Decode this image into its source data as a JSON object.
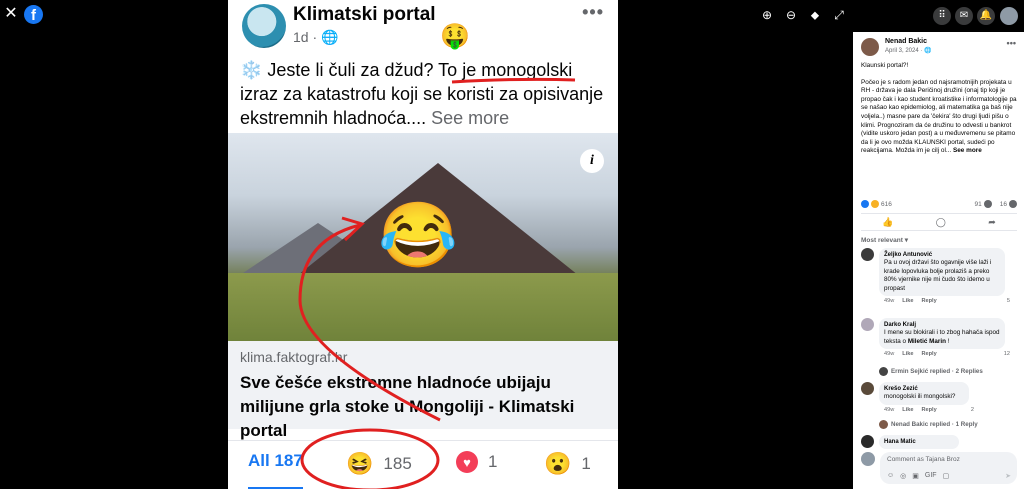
{
  "viewer": {
    "close_icon": "✕",
    "logo_letter": "f",
    "tools": [
      "⊕",
      "⊖",
      "⬥",
      "⤢"
    ]
  },
  "post": {
    "page_name": "Klimatski portal",
    "meta": "1d · ",
    "more": "•••",
    "money_emoji": "🤑",
    "text_prefix_emoji": "❄️",
    "text": " Jeste li čuli za džud? To je monogolski izraz za katastrofu koji se koristi za opisivanje ekstremnih hladnoća.... ",
    "see_more": "See more",
    "link": {
      "info_label": "i",
      "overlay_emoji": "😂",
      "domain": "klima.faktograf.hr",
      "title": "Sve češće ekstremne hladnoće ubijaju milijune grla stoke u Mongoliji - Klimatski portal"
    },
    "reactions": {
      "all_label": "All 187",
      "items": [
        {
          "emoji": "😆",
          "count": "185"
        },
        {
          "emoji": "♥",
          "count": "1"
        },
        {
          "emoji": "😮",
          "count": "1"
        }
      ]
    }
  },
  "topnav": {
    "menu_icon": "⠿",
    "messenger_icon": "✉",
    "bell_icon": "🔔"
  },
  "panel": {
    "author": "Nenad Bakic",
    "date": "April 3, 2024 · 🌐",
    "dots": "•••",
    "caption_p1": "Klaunski portal?!",
    "caption_p2": "Počeo je s radom jedan od najsramotnijih projekata u RH - država je dala Peričinoj družini (onaj tip koji je propao čak i kao student kroatistike i informatologije pa se našao kao epidemiolog, ali matematika ga baš nije voljela..) masne pare da 'čekira' što drugi ljudi pišu o klimi. Prognoziram da će družinu to odvesti u bankrot (vidite uskoro jedan post) a u međuvremenu se pitamo da li je ovo možda KLAUNSKI portal, sudeći po reakcijama. Možda im je cilj ol... ",
    "caption_see_more": "See more",
    "reaction_count": "616",
    "comments_count": "91",
    "shares_count": "16",
    "like_icon": "👍",
    "comment_icon": "◯",
    "share_icon": "➦",
    "most_relevant": "Most relevant ▾",
    "comments": [
      {
        "name": "Željko Antunović",
        "text": "Pa u ovoj državi što ogavnije više laži i krade lopovluka bolje prolaziš a preko 80% vjernike nije mi čudo što idemo u propast",
        "time": "49w",
        "like": "Like",
        "reply": "Reply",
        "react": "5"
      },
      {
        "name": "Darko Kralj",
        "text_a": "I mene su blokirali i to zbog hahača ispod teksta o ",
        "text_bold": "Miletić Marin",
        "text_b": " !",
        "time": "49w",
        "like": "Like",
        "reply": "Reply",
        "react": "12"
      },
      {
        "name": "Krešo Zezić",
        "text": "monogolski ili mongolski?",
        "time": "49w",
        "like": "Like",
        "reply": "Reply",
        "react": "2"
      },
      {
        "name": "Hana Matic",
        "text": ""
      }
    ],
    "replies": [
      "Ermin Sejkić replied · 2 Replies",
      "Nenad Bakic replied · 1 Reply"
    ],
    "comment_placeholder": "Comment as Tajana Broz",
    "comment_tools": [
      "☺",
      "◎",
      "▣",
      "GIF",
      "▢"
    ],
    "send_icon": "➤"
  }
}
